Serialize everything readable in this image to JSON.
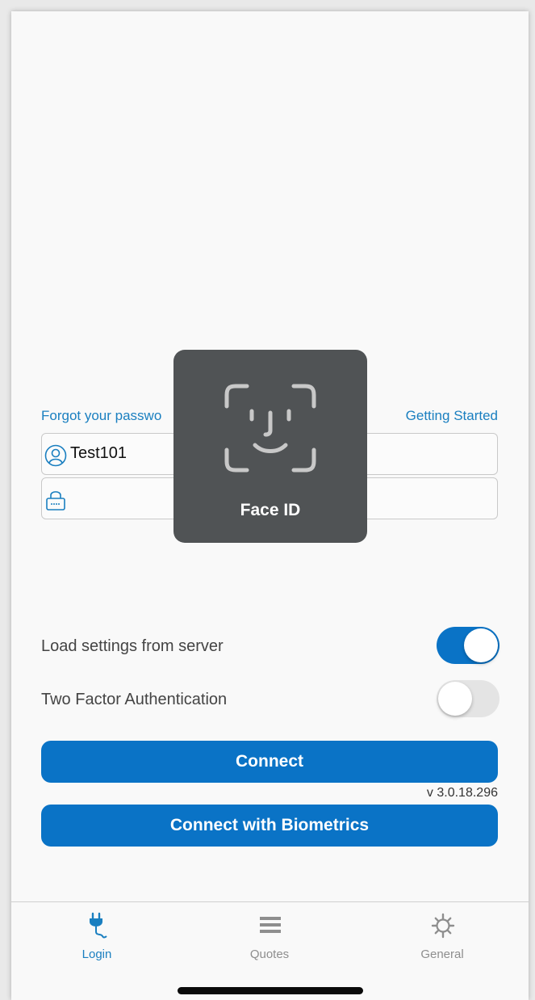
{
  "links": {
    "forgot": "Forgot your passwo",
    "getting_started": "Getting Started"
  },
  "username": {
    "value": "Test101",
    "icon": "user-icon"
  },
  "password": {
    "value": "",
    "icon": "lock-icon"
  },
  "settings": {
    "load_label": "Load settings from server",
    "load_on": true,
    "twofactor_label": "Two Factor Authentication",
    "twofactor_on": false
  },
  "buttons": {
    "connect": "Connect",
    "biometrics": "Connect with Biometrics"
  },
  "version": "v 3.0.18.296",
  "tabs": [
    {
      "label": "Login",
      "icon": "plug-icon",
      "active": true
    },
    {
      "label": "Quotes",
      "icon": "menu-icon",
      "active": false
    },
    {
      "label": "General",
      "icon": "gear-icon",
      "active": false
    }
  ],
  "faceid": {
    "label": "Face ID"
  },
  "colors": {
    "accent": "#0a73c6",
    "link": "#1a7fc0",
    "inactive_tab": "#8e8e8e",
    "overlay": "#505355"
  }
}
